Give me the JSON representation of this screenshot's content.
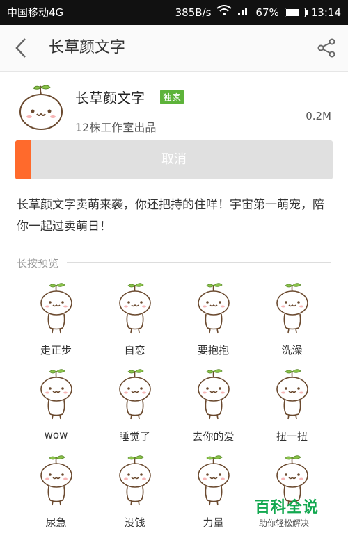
{
  "status_bar": {
    "carrier": "中国移动4G",
    "speed": "385B/s",
    "battery": "67%",
    "time": "13:14",
    "battery_level": 0.67
  },
  "header": {
    "title": "长草颜文字"
  },
  "app": {
    "name": "长草颜文字",
    "badge": "独家",
    "publisher": "12株工作室出品",
    "size": "0.2M",
    "download_progress": 0.05,
    "action_label": "取消",
    "description": "长草颜文字卖萌来袭，你还把持的住咩！宇宙第一萌宠，陪你一起过卖萌日！"
  },
  "preview": {
    "section_title": "长按预览",
    "stickers": [
      {
        "label": "走正步"
      },
      {
        "label": "自恋"
      },
      {
        "label": "要抱抱"
      },
      {
        "label": "洗澡"
      },
      {
        "label": "wow"
      },
      {
        "label": "睡觉了"
      },
      {
        "label": "去你的爱"
      },
      {
        "label": "扭一扭"
      },
      {
        "label": "尿急"
      },
      {
        "label": "没钱"
      },
      {
        "label": "力量"
      },
      {
        "label": ""
      }
    ]
  },
  "watermark": {
    "brand": "百科全说",
    "slogan": "助你轻松解决"
  },
  "colors": {
    "accent": "#ff6a2c",
    "badge": "#5db33a",
    "watermark": "#12a84f"
  }
}
